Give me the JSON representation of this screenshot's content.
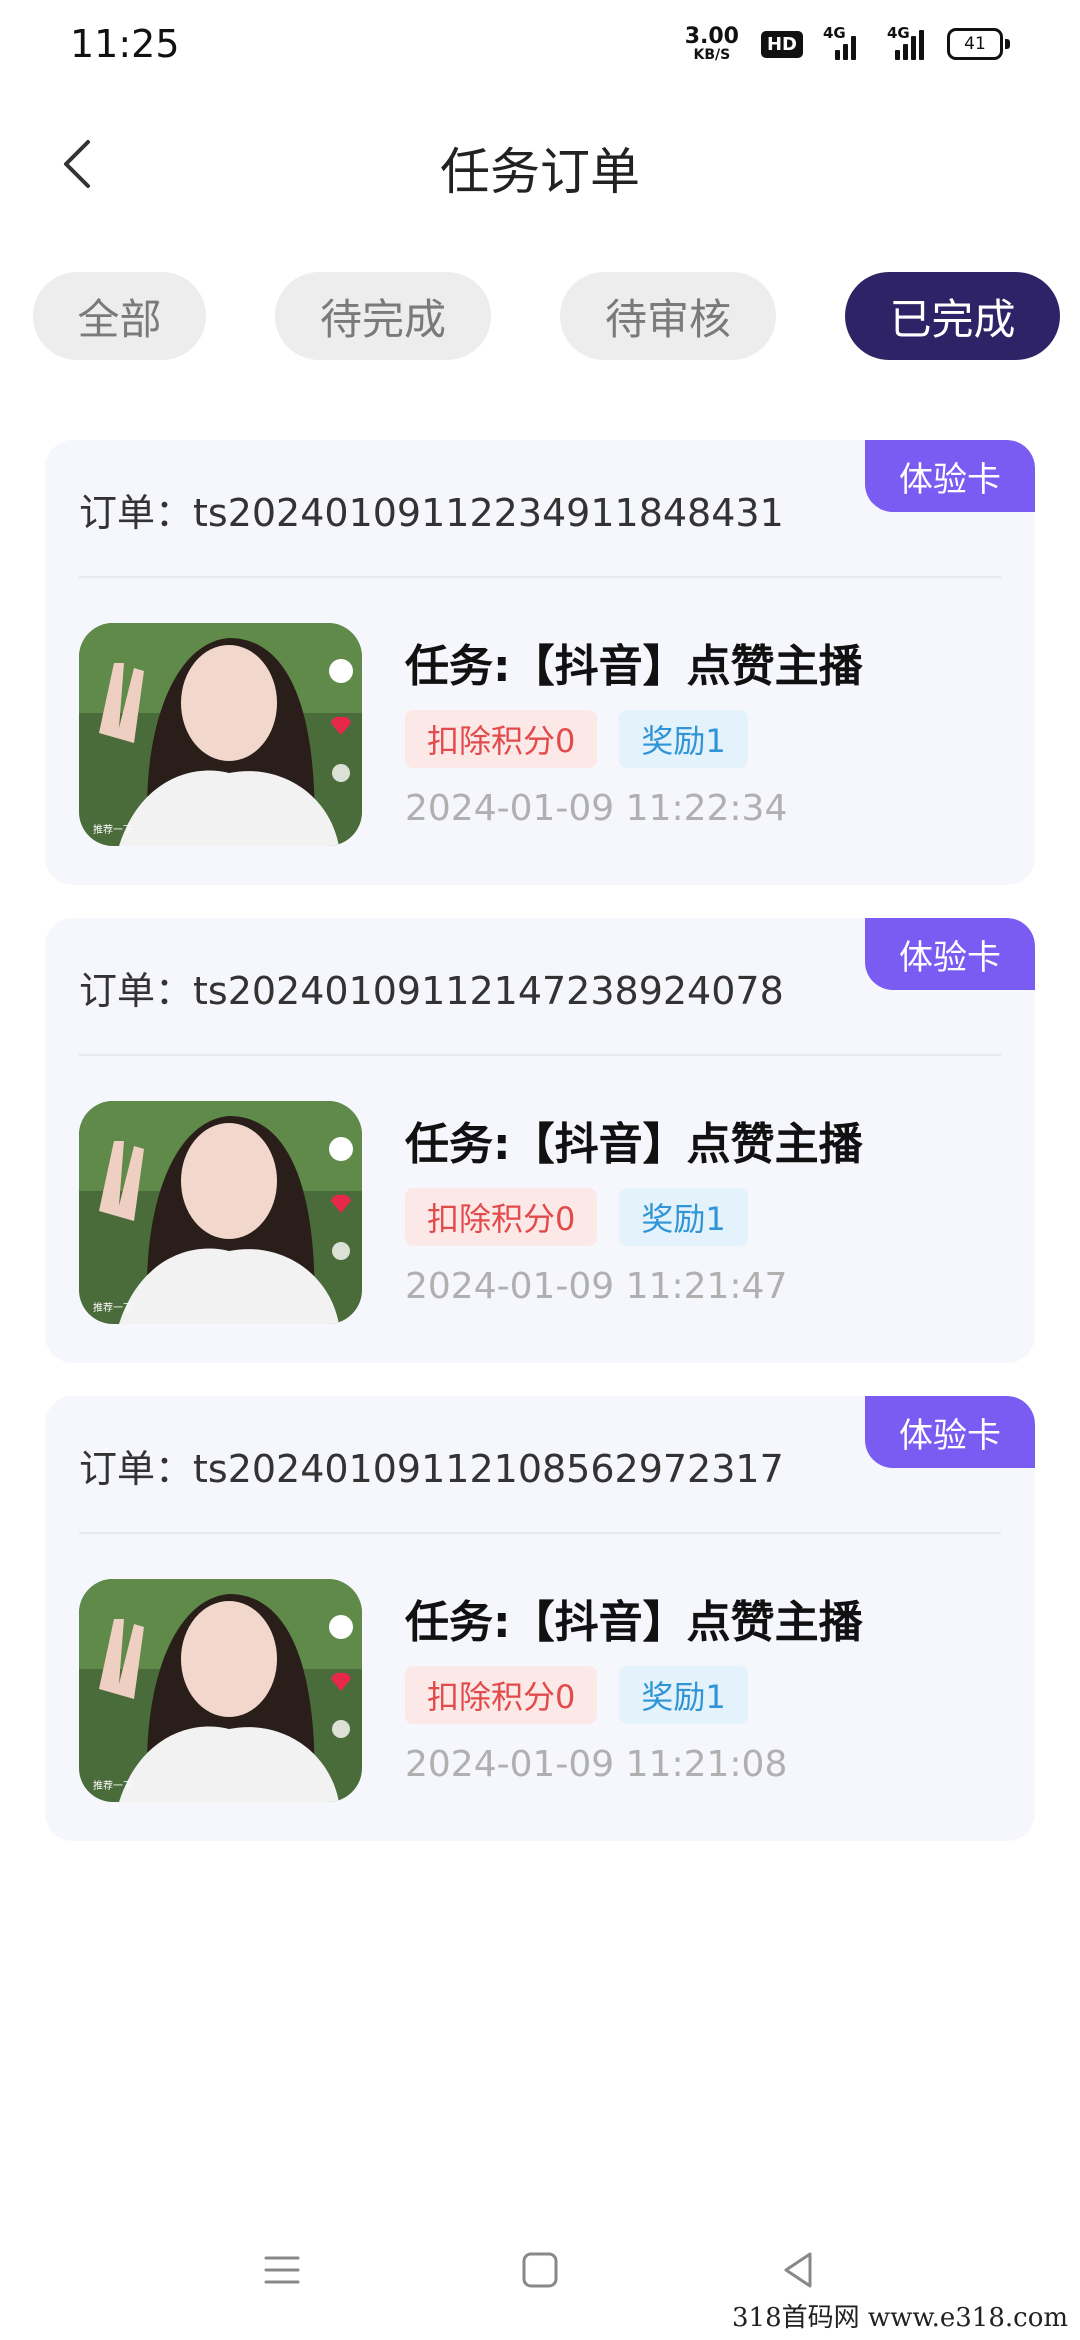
{
  "status_bar": {
    "time": "11:25",
    "net_speed_value": "3.00",
    "net_speed_unit": "KB/S",
    "hd_label": "HD",
    "signal1_label": "4G",
    "signal2_label": "4G",
    "battery_level": "41"
  },
  "header": {
    "title": "任务订单",
    "back_icon": "chevron-left-icon"
  },
  "tabs": [
    {
      "label": "全部",
      "active": false
    },
    {
      "label": "待完成",
      "active": false
    },
    {
      "label": "待审核",
      "active": false
    },
    {
      "label": "已完成",
      "active": true
    }
  ],
  "orders": [
    {
      "badge": "体验卡",
      "order_no": "订单：ts2024010911223491184843​1",
      "task_title": "任务:【抖音】点赞主播",
      "deduct_tag": "扣除积分0",
      "reward_tag": "奖励1",
      "time": "2024-01-09 11:22:34"
    },
    {
      "badge": "体验卡",
      "order_no": "订单：ts20240109112147238924078",
      "task_title": "任务:【抖音】点赞主播",
      "deduct_tag": "扣除积分0",
      "reward_tag": "奖励1",
      "time": "2024-01-09 11:21:47"
    },
    {
      "badge": "体验卡",
      "order_no": "订单：ts20240109112108562972317",
      "task_title": "任务:【抖音】点赞主播",
      "deduct_tag": "扣除积分0",
      "reward_tag": "奖励1",
      "time": "2024-01-09 11:21:08"
    }
  ],
  "thumb_caption": "推荐一下",
  "nav_bar": {
    "menu_icon": "menu-icon",
    "home_icon": "home-square-icon",
    "back_icon": "back-triangle-icon"
  },
  "watermark": "318首码网 www.e318.com",
  "colors": {
    "active_tab": "#2f2367",
    "badge": "#7b5cf3",
    "card_bg": "#f6f6fd",
    "deduct_text": "#e24b4b",
    "reward_text": "#2f95d6"
  }
}
